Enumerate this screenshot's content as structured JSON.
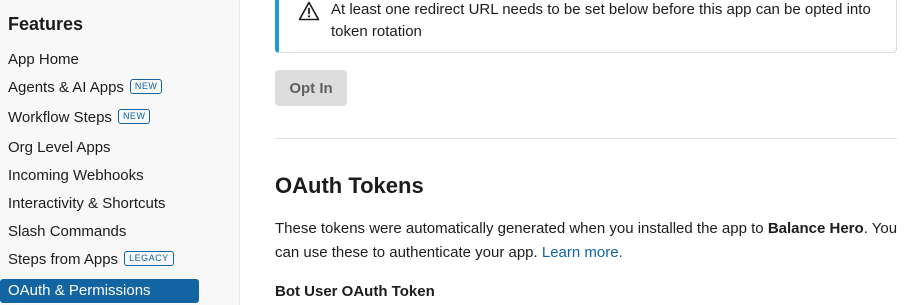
{
  "sidebar": {
    "heading": "Features",
    "items": [
      {
        "label": "App Home",
        "badge": null,
        "active": false
      },
      {
        "label": "Agents & AI Apps",
        "badge": "NEW",
        "active": false
      },
      {
        "label": "Workflow Steps",
        "badge": "NEW",
        "active": false
      },
      {
        "label": "Org Level Apps",
        "badge": null,
        "active": false
      },
      {
        "label": "Incoming Webhooks",
        "badge": null,
        "active": false
      },
      {
        "label": "Interactivity & Shortcuts",
        "badge": null,
        "active": false
      },
      {
        "label": "Slash Commands",
        "badge": null,
        "active": false
      },
      {
        "label": "Steps from Apps",
        "badge": "LEGACY",
        "active": false
      },
      {
        "label": "OAuth & Permissions",
        "badge": null,
        "active": true
      }
    ]
  },
  "alert": {
    "icon": "warning-icon",
    "text": "At least one redirect URL needs to be set below before this app can be opted into token rotation"
  },
  "opt_in": {
    "label": "Opt In"
  },
  "oauth_tokens": {
    "title": "OAuth Tokens",
    "description_prefix": "These tokens were automatically generated when you installed the app to ",
    "workspace_name": "Balance Hero",
    "description_suffix": ". You can use these to authenticate your app. ",
    "learn_more": "Learn more.",
    "bot_token_label": "Bot User OAuth Token"
  },
  "colors": {
    "accent": "#1264a3",
    "alert_border": "#1d9bd1",
    "sidebar_bg": "#f8f8f8",
    "button_disabled_bg": "#dddddd"
  }
}
